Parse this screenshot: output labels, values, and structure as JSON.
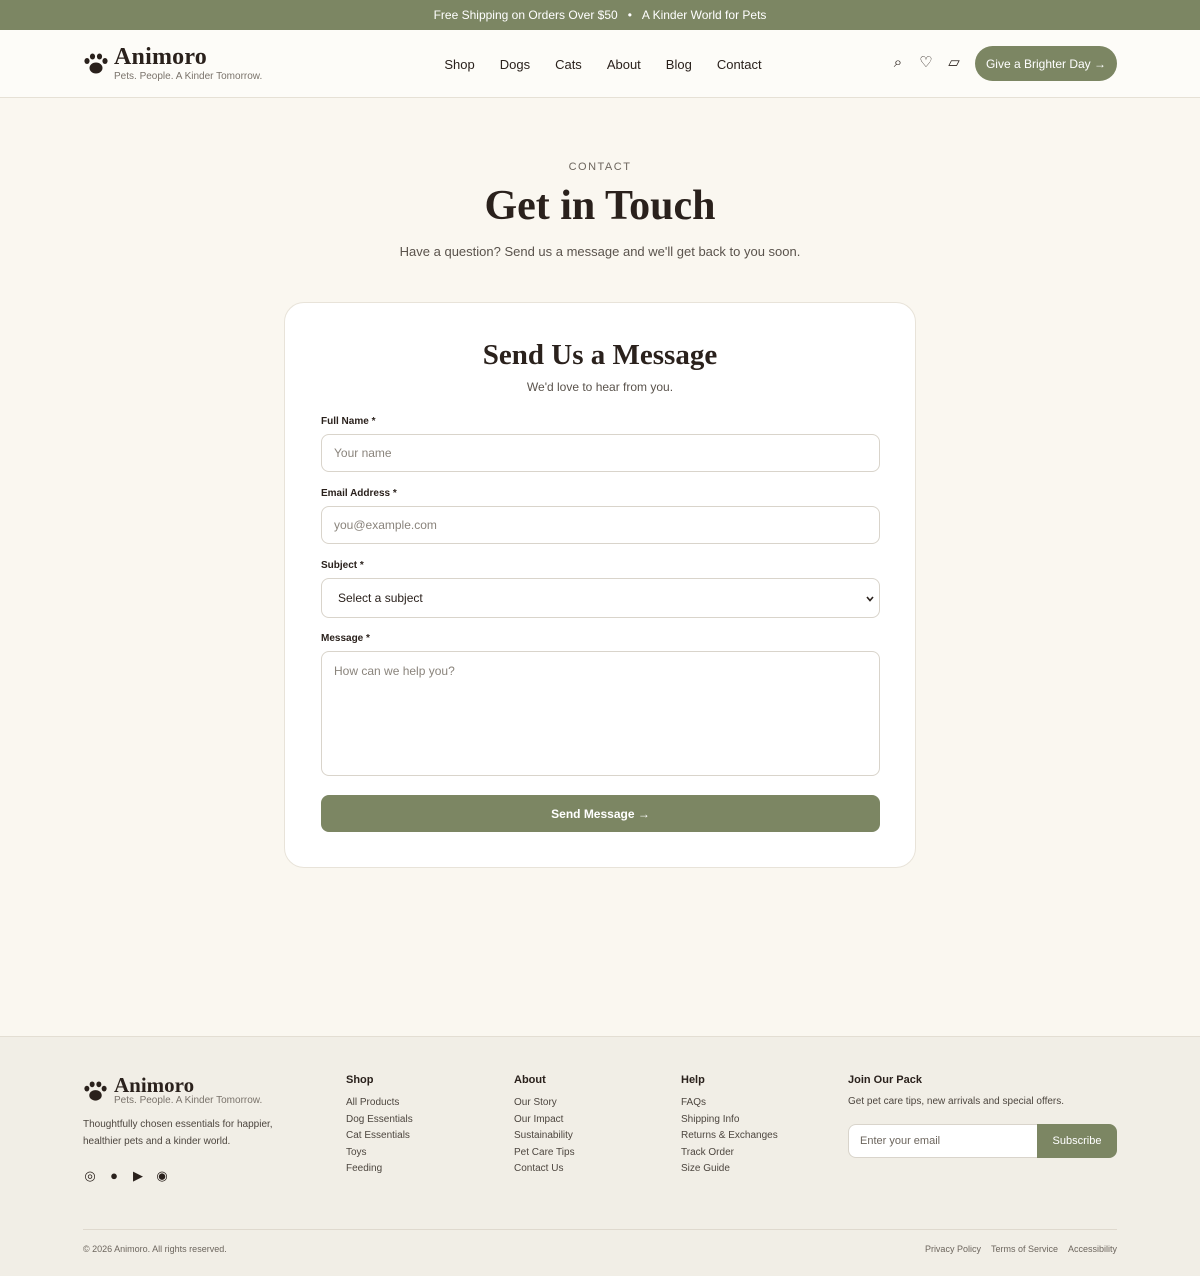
{
  "announcement": {
    "left": "Free Shipping on Orders Over $50",
    "separator": "•",
    "right": "A Kinder World for Pets"
  },
  "brand": {
    "name": "Animoro",
    "tagline": "Pets. People. A Kinder Tomorrow."
  },
  "nav": [
    "Shop",
    "Dogs",
    "Cats",
    "About",
    "Blog",
    "Contact"
  ],
  "header_icons": {
    "search": "⌕",
    "wishlist": "♡",
    "cart": "▱"
  },
  "cta_label": "Give a Brighter Day →",
  "hero": {
    "eyebrow": "CONTACT",
    "title": "Get in Touch",
    "subtitle": "Have a question? Send us a message and we'll get back to you soon."
  },
  "form": {
    "title": "Send Us a Message",
    "subtitle": "We'd love to hear from you.",
    "name_label": "Full Name *",
    "name_placeholder": "Your name",
    "email_label": "Email Address *",
    "email_placeholder": "you@example.com",
    "subject_label": "Subject *",
    "subject_selected": "Select a subject",
    "message_label": "Message *",
    "message_placeholder": "How can we help you?",
    "submit_label": "Send Message →"
  },
  "footer": {
    "description": "Thoughtfully chosen essentials for happier, healthier pets and a kinder world.",
    "social_icons": [
      "◎",
      "●",
      "▶",
      "◉"
    ],
    "columns": [
      {
        "title": "Shop",
        "links": [
          "All Products",
          "Dog Essentials",
          "Cat Essentials",
          "Toys",
          "Feeding"
        ]
      },
      {
        "title": "About",
        "links": [
          "Our Story",
          "Our Impact",
          "Sustainability",
          "Pet Care Tips",
          "Contact Us"
        ]
      },
      {
        "title": "Help",
        "links": [
          "FAQs",
          "Shipping Info",
          "Returns & Exchanges",
          "Track Order",
          "Size Guide"
        ]
      }
    ],
    "newsletter": {
      "title": "Join Our Pack",
      "text": "Get pet care tips, new arrivals and special offers.",
      "placeholder": "Enter your email",
      "button": "Subscribe"
    },
    "copyright": "© 2026 Animoro. All rights reserved.",
    "legal": [
      "Privacy Policy",
      "Terms of Service",
      "Accessibility"
    ]
  },
  "colors": {
    "accent": "#7c8663",
    "page_bg": "#faf7f0",
    "footer_bg": "#f1eee6",
    "text": "#2a211c"
  }
}
